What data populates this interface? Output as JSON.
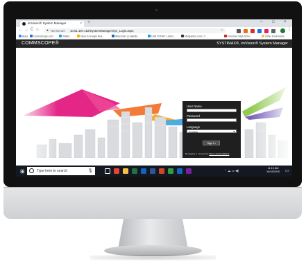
{
  "browser": {
    "tab_title": "imVision® System Manager",
    "tab_close": "×",
    "new_tab": "+",
    "window_controls": [
      "–",
      "□",
      "×"
    ],
    "nav": {
      "back": "←",
      "forward": "→",
      "reload": "C",
      "home": "⌂"
    },
    "security_label": "Not secure",
    "url": "10.61.187.152/SystemManager/Sys_Login.aspx",
    "bookmarks": [
      {
        "label": "Apps",
        "color": "#4285f4"
      },
      {
        "label": "CommScope.com",
        "color": "#1a73e8"
      },
      {
        "label": "Twitter",
        "color": "#1da1f2"
      },
      {
        "label": "View in Google Ana...",
        "color": "#f9ab00"
      },
      {
        "label": "Welcome! | LinkedIn",
        "color": "#0a66c2"
      },
      {
        "label": "USA TODAY: Latest...",
        "color": "#009bff"
      },
      {
        "label": "Morganton.com | T...",
        "color": "#333333"
      },
      {
        "label": "Freedom High Scho...",
        "color": "#c62828"
      }
    ],
    "other_bookmarks": "Other bookmarks",
    "extensions": [
      "#555555",
      "#e8710a",
      "#d93025",
      "#1a73e8",
      "#e91e63",
      "#5f6368"
    ]
  },
  "app": {
    "logo": "COMMSCOPE®",
    "product": "SYSTIMAX®, imVision® System Manager"
  },
  "login": {
    "username_label": "User Name",
    "username_value": "",
    "password_label": "Password",
    "password_value": "",
    "language_label": "Language",
    "language_selected": "English",
    "signin_label": "Sign In",
    "terms_prefix": "By logging in I accept the ",
    "terms_link": "Terms and Conditions"
  },
  "taskbar": {
    "start_glyph": "⊞",
    "search_placeholder": "Type here to search",
    "apps": [
      {
        "name": "task-view",
        "color": "#ffffff"
      },
      {
        "name": "chrome",
        "color": "#ea4335"
      },
      {
        "name": "file-explorer",
        "color": "#f5c242"
      },
      {
        "name": "excel",
        "color": "#1e7145"
      },
      {
        "name": "outlook",
        "color": "#0f64c2"
      },
      {
        "name": "word",
        "color": "#2b579a"
      },
      {
        "name": "powerpoint",
        "color": "#d24726"
      },
      {
        "name": "app-7",
        "color": "#2f9e44"
      },
      {
        "name": "app-8",
        "color": "#1565c0"
      },
      {
        "name": "app-9",
        "color": "#7b1fa2"
      }
    ],
    "tray": "⌃  ☁  ▭  ◀)",
    "time": "11:19 AM",
    "date": "10/19/2020",
    "notification_glyph": "▭"
  },
  "colors": {
    "app_header": "#262626",
    "login_panel": "#1f1f1f",
    "bezel": "#111111",
    "taskbar": "#141820",
    "ribbons": [
      "#e10f7a",
      "#f26b21",
      "#f7a21b",
      "#86c440",
      "#3aa3df",
      "#6a4fb1"
    ]
  }
}
